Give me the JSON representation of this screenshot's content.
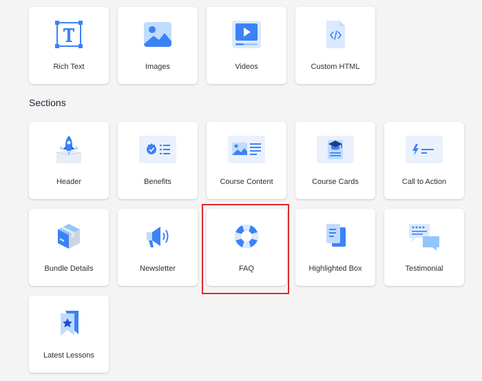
{
  "blocks": [
    {
      "label": "Rich Text",
      "icon": "rich-text-icon"
    },
    {
      "label": "Images",
      "icon": "image-icon"
    },
    {
      "label": "Videos",
      "icon": "video-icon"
    },
    {
      "label": "Custom HTML",
      "icon": "code-file-icon"
    }
  ],
  "sections_title": "Sections",
  "sections": [
    {
      "label": "Header",
      "icon": "rocket-icon"
    },
    {
      "label": "Benefits",
      "icon": "badge-list-icon"
    },
    {
      "label": "Course Content",
      "icon": "image-list-icon"
    },
    {
      "label": "Course Cards",
      "icon": "graduation-cap-icon"
    },
    {
      "label": "Call to Action",
      "icon": "lightning-icon"
    },
    {
      "label": "Bundle Details",
      "icon": "box-icon"
    },
    {
      "label": "Newsletter",
      "icon": "megaphone-icon"
    },
    {
      "label": "FAQ",
      "icon": "lifebuoy-icon"
    },
    {
      "label": "Highlighted Box",
      "icon": "documents-icon"
    },
    {
      "label": "Testimonial",
      "icon": "chat-bubbles-icon"
    },
    {
      "label": "Latest Lessons",
      "icon": "bookmark-star-icon"
    }
  ],
  "selected": "FAQ",
  "colors": {
    "accent": "#3b82f6",
    "accent_light": "#bfdbfe",
    "selection": "#e0282a"
  }
}
